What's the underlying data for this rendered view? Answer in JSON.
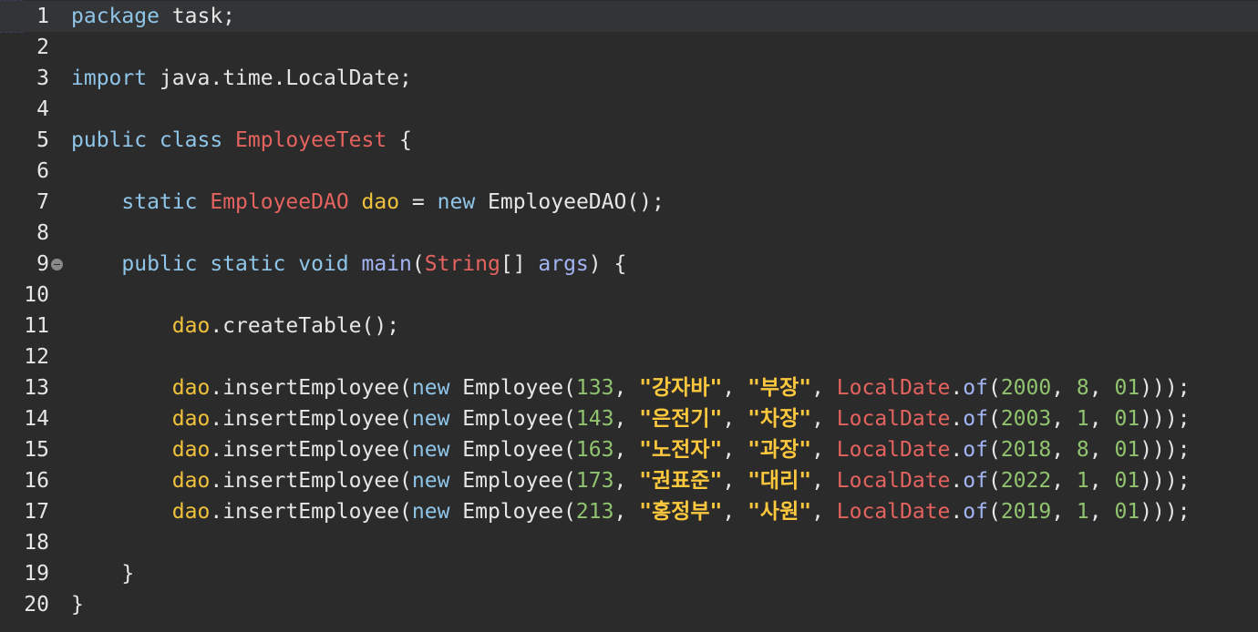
{
  "editor": {
    "language": "java",
    "colors": {
      "background": "#2b2b2b",
      "current_line": "#323436",
      "default_text": "#e6e6e6",
      "keyword": "#8fc5e8",
      "class_name": "#e5635f",
      "field": "#f0c23c",
      "string": "#ffc83d",
      "number": "#90c46e",
      "method": "#a4b5f5"
    },
    "fold_marker_line": 9,
    "lines": [
      {
        "n": "1",
        "tokens": [
          {
            "t": "package",
            "c": "kw"
          },
          {
            "t": " task;",
            "c": ""
          }
        ]
      },
      {
        "n": "2",
        "tokens": []
      },
      {
        "n": "3",
        "tokens": [
          {
            "t": "import",
            "c": "kw"
          },
          {
            "t": " java.time.LocalDate;",
            "c": ""
          }
        ]
      },
      {
        "n": "4",
        "tokens": []
      },
      {
        "n": "5",
        "tokens": [
          {
            "t": "public class",
            "c": "kw"
          },
          {
            "t": " ",
            "c": ""
          },
          {
            "t": "EmployeeTest",
            "c": "cls"
          },
          {
            "t": " {",
            "c": ""
          }
        ]
      },
      {
        "n": "6",
        "tokens": []
      },
      {
        "n": "7",
        "tokens": [
          {
            "t": "    ",
            "c": ""
          },
          {
            "t": "static",
            "c": "kw"
          },
          {
            "t": " ",
            "c": ""
          },
          {
            "t": "EmployeeDAO",
            "c": "cls"
          },
          {
            "t": " ",
            "c": ""
          },
          {
            "t": "dao",
            "c": "fld"
          },
          {
            "t": " = ",
            "c": ""
          },
          {
            "t": "new",
            "c": "kw"
          },
          {
            "t": " EmployeeDAO();",
            "c": ""
          }
        ]
      },
      {
        "n": "8",
        "tokens": []
      },
      {
        "n": "9",
        "tokens": [
          {
            "t": "    ",
            "c": ""
          },
          {
            "t": "public static void",
            "c": "kw"
          },
          {
            "t": " ",
            "c": ""
          },
          {
            "t": "main",
            "c": "mth"
          },
          {
            "t": "(",
            "c": ""
          },
          {
            "t": "String",
            "c": "cls"
          },
          {
            "t": "[] ",
            "c": ""
          },
          {
            "t": "args",
            "c": "par"
          },
          {
            "t": ") {",
            "c": ""
          }
        ]
      },
      {
        "n": "10",
        "tokens": []
      },
      {
        "n": "11",
        "tokens": [
          {
            "t": "        ",
            "c": ""
          },
          {
            "t": "dao",
            "c": "fld"
          },
          {
            "t": ".createTable();",
            "c": ""
          }
        ]
      },
      {
        "n": "12",
        "tokens": []
      },
      {
        "n": "13",
        "tokens": [
          {
            "t": "        ",
            "c": ""
          },
          {
            "t": "dao",
            "c": "fld"
          },
          {
            "t": ".insertEmployee(",
            "c": ""
          },
          {
            "t": "new",
            "c": "kw"
          },
          {
            "t": " Employee(",
            "c": ""
          },
          {
            "t": "133",
            "c": "num"
          },
          {
            "t": ", ",
            "c": ""
          },
          {
            "t": "\"강자바\"",
            "c": "str"
          },
          {
            "t": ", ",
            "c": ""
          },
          {
            "t": "\"부장\"",
            "c": "str"
          },
          {
            "t": ", ",
            "c": ""
          },
          {
            "t": "LocalDate",
            "c": "cls"
          },
          {
            "t": ".",
            "c": ""
          },
          {
            "t": "of",
            "c": "mth"
          },
          {
            "t": "(",
            "c": ""
          },
          {
            "t": "2000",
            "c": "num"
          },
          {
            "t": ", ",
            "c": ""
          },
          {
            "t": "8",
            "c": "num"
          },
          {
            "t": ", ",
            "c": ""
          },
          {
            "t": "01",
            "c": "num"
          },
          {
            "t": ")));",
            "c": ""
          }
        ]
      },
      {
        "n": "14",
        "tokens": [
          {
            "t": "        ",
            "c": ""
          },
          {
            "t": "dao",
            "c": "fld"
          },
          {
            "t": ".insertEmployee(",
            "c": ""
          },
          {
            "t": "new",
            "c": "kw"
          },
          {
            "t": " Employee(",
            "c": ""
          },
          {
            "t": "143",
            "c": "num"
          },
          {
            "t": ", ",
            "c": ""
          },
          {
            "t": "\"은전기\"",
            "c": "str"
          },
          {
            "t": ", ",
            "c": ""
          },
          {
            "t": "\"차장\"",
            "c": "str"
          },
          {
            "t": ", ",
            "c": ""
          },
          {
            "t": "LocalDate",
            "c": "cls"
          },
          {
            "t": ".",
            "c": ""
          },
          {
            "t": "of",
            "c": "mth"
          },
          {
            "t": "(",
            "c": ""
          },
          {
            "t": "2003",
            "c": "num"
          },
          {
            "t": ", ",
            "c": ""
          },
          {
            "t": "1",
            "c": "num"
          },
          {
            "t": ", ",
            "c": ""
          },
          {
            "t": "01",
            "c": "num"
          },
          {
            "t": ")));",
            "c": ""
          }
        ]
      },
      {
        "n": "15",
        "tokens": [
          {
            "t": "        ",
            "c": ""
          },
          {
            "t": "dao",
            "c": "fld"
          },
          {
            "t": ".insertEmployee(",
            "c": ""
          },
          {
            "t": "new",
            "c": "kw"
          },
          {
            "t": " Employee(",
            "c": ""
          },
          {
            "t": "163",
            "c": "num"
          },
          {
            "t": ", ",
            "c": ""
          },
          {
            "t": "\"노전자\"",
            "c": "str"
          },
          {
            "t": ", ",
            "c": ""
          },
          {
            "t": "\"과장\"",
            "c": "str"
          },
          {
            "t": ", ",
            "c": ""
          },
          {
            "t": "LocalDate",
            "c": "cls"
          },
          {
            "t": ".",
            "c": ""
          },
          {
            "t": "of",
            "c": "mth"
          },
          {
            "t": "(",
            "c": ""
          },
          {
            "t": "2018",
            "c": "num"
          },
          {
            "t": ", ",
            "c": ""
          },
          {
            "t": "8",
            "c": "num"
          },
          {
            "t": ", ",
            "c": ""
          },
          {
            "t": "01",
            "c": "num"
          },
          {
            "t": ")));",
            "c": ""
          }
        ]
      },
      {
        "n": "16",
        "tokens": [
          {
            "t": "        ",
            "c": ""
          },
          {
            "t": "dao",
            "c": "fld"
          },
          {
            "t": ".insertEmployee(",
            "c": ""
          },
          {
            "t": "new",
            "c": "kw"
          },
          {
            "t": " Employee(",
            "c": ""
          },
          {
            "t": "173",
            "c": "num"
          },
          {
            "t": ", ",
            "c": ""
          },
          {
            "t": "\"권표준\"",
            "c": "str"
          },
          {
            "t": ", ",
            "c": ""
          },
          {
            "t": "\"대리\"",
            "c": "str"
          },
          {
            "t": ", ",
            "c": ""
          },
          {
            "t": "LocalDate",
            "c": "cls"
          },
          {
            "t": ".",
            "c": ""
          },
          {
            "t": "of",
            "c": "mth"
          },
          {
            "t": "(",
            "c": ""
          },
          {
            "t": "2022",
            "c": "num"
          },
          {
            "t": ", ",
            "c": ""
          },
          {
            "t": "1",
            "c": "num"
          },
          {
            "t": ", ",
            "c": ""
          },
          {
            "t": "01",
            "c": "num"
          },
          {
            "t": ")));",
            "c": ""
          }
        ]
      },
      {
        "n": "17",
        "tokens": [
          {
            "t": "        ",
            "c": ""
          },
          {
            "t": "dao",
            "c": "fld"
          },
          {
            "t": ".insertEmployee(",
            "c": ""
          },
          {
            "t": "new",
            "c": "kw"
          },
          {
            "t": " Employee(",
            "c": ""
          },
          {
            "t": "213",
            "c": "num"
          },
          {
            "t": ", ",
            "c": ""
          },
          {
            "t": "\"홍정부\"",
            "c": "str"
          },
          {
            "t": ", ",
            "c": ""
          },
          {
            "t": "\"사원\"",
            "c": "str"
          },
          {
            "t": ", ",
            "c": ""
          },
          {
            "t": "LocalDate",
            "c": "cls"
          },
          {
            "t": ".",
            "c": ""
          },
          {
            "t": "of",
            "c": "mth"
          },
          {
            "t": "(",
            "c": ""
          },
          {
            "t": "2019",
            "c": "num"
          },
          {
            "t": ", ",
            "c": ""
          },
          {
            "t": "1",
            "c": "num"
          },
          {
            "t": ", ",
            "c": ""
          },
          {
            "t": "01",
            "c": "num"
          },
          {
            "t": ")));",
            "c": ""
          }
        ]
      },
      {
        "n": "18",
        "tokens": []
      },
      {
        "n": "19",
        "tokens": [
          {
            "t": "    }",
            "c": ""
          }
        ]
      },
      {
        "n": "20",
        "tokens": [
          {
            "t": "}",
            "c": ""
          }
        ]
      }
    ]
  }
}
